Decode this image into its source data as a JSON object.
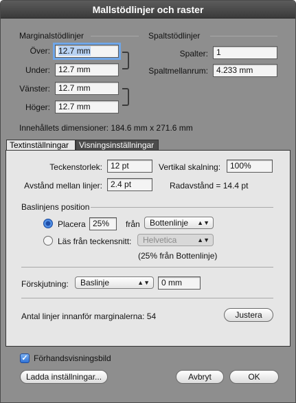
{
  "window": {
    "title": "Mallstödlinjer och raster"
  },
  "margin_guides": {
    "header": "Marginalstödlinjer",
    "top_label": "Över:",
    "top_value": "12.7 mm",
    "bottom_label": "Under:",
    "bottom_value": "12.7 mm",
    "left_label": "Vänster:",
    "left_value": "12.7 mm",
    "right_label": "Höger:",
    "right_value": "12.7 mm"
  },
  "column_guides": {
    "header": "Spaltstödlinjer",
    "columns_label": "Spalter:",
    "columns_value": "1",
    "gutter_label": "Spaltmellanrum:",
    "gutter_value": "4.233 mm"
  },
  "content_dimensions": "Innehållets dimensioner:  184.6 mm x 271.6 mm",
  "tabs": [
    {
      "label": "Textinställningar",
      "active": true
    },
    {
      "label": "Visningsinställningar",
      "active": false
    }
  ],
  "text_settings": {
    "font_size_label": "Teckenstorlek:",
    "font_size_value": "12 pt",
    "vscale_label": "Vertikal skalning:",
    "vscale_value": "100%",
    "line_spacing_label": "Avstånd mellan linjer:",
    "line_spacing_value": "2.4 pt",
    "leading_text": "Radavstånd  =  14.4 pt",
    "baseline_header": "Baslinjens position",
    "place_label": "Placera",
    "place_value": "25%",
    "from_label": "från",
    "place_from_option": "Bottenlinje",
    "read_from_font_label": "Läs från teckensnitt:",
    "font_option": "Helvetica",
    "computed_note": "(25% från Bottenlinje)",
    "offset_label": "Förskjutning:",
    "offset_option": "Baslinje",
    "offset_value": "0 mm",
    "lines_in_margins": "Antal linjer innanför marginalerna:  54",
    "adjust_button": "Justera"
  },
  "footer": {
    "preview_label": "Förhandsvisningsbild",
    "preview_checked": true,
    "load_button": "Ladda inställningar...",
    "cancel_button": "Avbryt",
    "ok_button": "OK"
  }
}
